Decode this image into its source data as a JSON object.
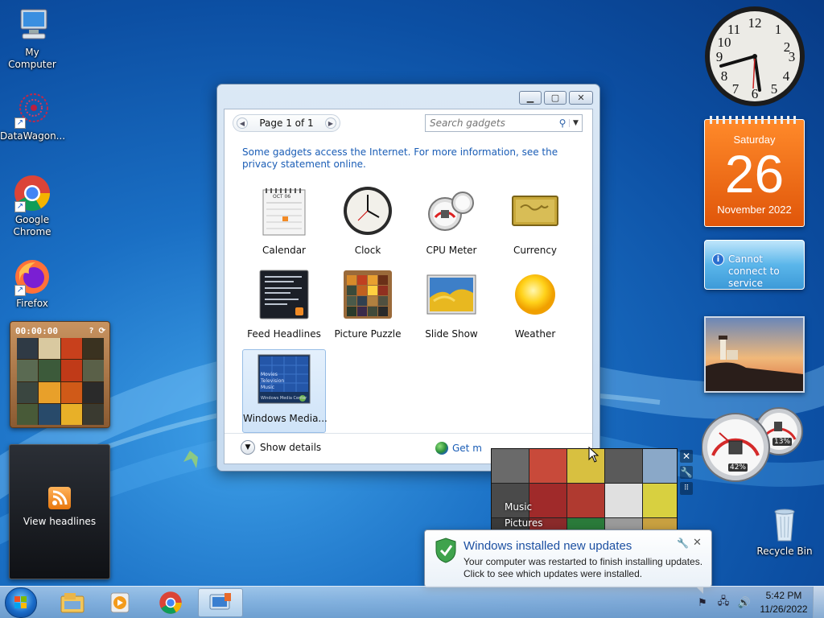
{
  "desktop": {
    "icons": [
      {
        "label": "My Computer",
        "icon": "computer-icon"
      },
      {
        "label": "DataWagon...",
        "icon": "datawagon-icon"
      },
      {
        "label": "Google Chrome",
        "icon": "chrome-icon"
      },
      {
        "label": "Firefox",
        "icon": "firefox-icon"
      },
      {
        "label": "Recycle Bin",
        "icon": "recycle-bin-icon"
      }
    ]
  },
  "gadget_gallery": {
    "pager": "Page 1 of 1",
    "search_placeholder": "Search gadgets",
    "notice": "Some gadgets access the Internet.  For more information, see the privacy statement online.",
    "gadgets": [
      {
        "label": "Calendar",
        "icon": "calendar-icon"
      },
      {
        "label": "Clock",
        "icon": "clock-icon"
      },
      {
        "label": "CPU Meter",
        "icon": "cpu-meter-icon"
      },
      {
        "label": "Currency",
        "icon": "currency-icon"
      },
      {
        "label": "Feed Headlines",
        "icon": "feed-headlines-icon"
      },
      {
        "label": "Picture Puzzle",
        "icon": "picture-puzzle-icon"
      },
      {
        "label": "Slide Show",
        "icon": "slide-show-icon"
      },
      {
        "label": "Weather",
        "icon": "weather-icon"
      },
      {
        "label": "Windows Media...",
        "icon": "windows-media-center-icon",
        "selected": true
      }
    ],
    "show_details": "Show details",
    "get_more": "Get m",
    "window_buttons": {
      "minimize": "minimize-icon",
      "maximize": "maximize-icon",
      "close": "close-icon"
    }
  },
  "gallery_calendar_preview": {
    "month": "OCT 06"
  },
  "sidebar": {
    "calendar": {
      "weekday": "Saturday",
      "day": "26",
      "month_year": "November 2022"
    },
    "currency": {
      "message": "Cannot connect to service"
    },
    "cpu": {
      "cpu_percent": "42%",
      "memory_percent": "13%"
    }
  },
  "puzzle": {
    "timer": "00:00:00"
  },
  "feed": {
    "label": "View headlines"
  },
  "media_center_preview": {
    "items": [
      "Music",
      "Pictures"
    ]
  },
  "media_center_gallery_preview": {
    "items": [
      "Movies",
      "Television",
      "Music"
    ],
    "footer": "Windows Media Center"
  },
  "notification": {
    "title": "Windows installed new updates",
    "line1": "Your computer was restarted to finish installing updates.",
    "line2": "Click to see which updates were installed."
  },
  "taskbar": {
    "pinned": [
      "explorer-icon",
      "media-player-icon",
      "chrome-icon",
      "gadgets-icon"
    ],
    "tray_icons": [
      "action-center-icon",
      "network-icon",
      "volume-icon"
    ],
    "time": "5:42 PM",
    "date": "11/26/2022"
  },
  "colors": {
    "link": "#1a5db6",
    "calendar_orange": "#e8650f",
    "title_blue": "#1d50a2"
  }
}
